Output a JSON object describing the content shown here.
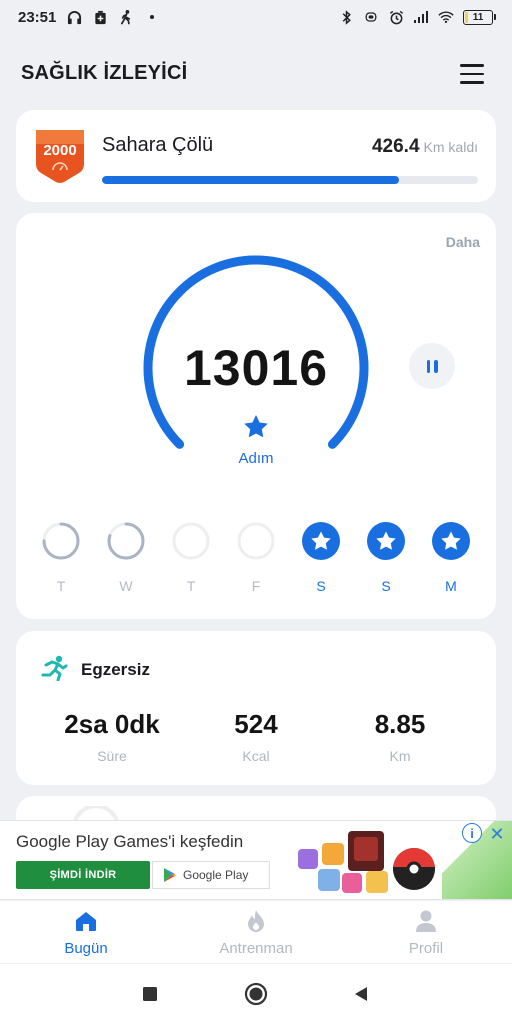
{
  "status_bar": {
    "time": "23:51",
    "battery_level": "11",
    "icons": [
      "headphones-icon",
      "battery-saver-icon",
      "walking-icon",
      "dot-icon",
      "bluetooth-icon",
      "vibrate-icon",
      "alarm-icon",
      "signal-icon",
      "wifi-icon",
      "battery-icon"
    ]
  },
  "app_bar": {
    "title": "SAĞLIK İZLEYİCİ",
    "menu_icon": "hamburger-menu-icon"
  },
  "challenge": {
    "badge_number": "2000",
    "name": "Sahara Çölü",
    "remaining_value": "426.4",
    "remaining_unit": "Km kaldı",
    "progress_fraction": 0.79,
    "accent_color": "#e8541f"
  },
  "steps": {
    "more_label": "Daha",
    "value": "13016",
    "unit_label": "Adım",
    "gauge_fraction": 1.0,
    "gauge_color": "#1a6fe0",
    "pause_icon": "pause-icon",
    "week": [
      {
        "label": "T",
        "state": "partial",
        "fraction": 0.75
      },
      {
        "label": "W",
        "state": "partial",
        "fraction": 0.8
      },
      {
        "label": "T",
        "state": "empty",
        "fraction": 0
      },
      {
        "label": "F",
        "state": "empty",
        "fraction": 0
      },
      {
        "label": "S",
        "state": "done",
        "fraction": 1
      },
      {
        "label": "S",
        "state": "done",
        "fraction": 1
      },
      {
        "label": "M",
        "state": "done",
        "fraction": 1
      }
    ]
  },
  "exercise": {
    "title": "Egzersiz",
    "icon": "running-person-icon",
    "stats": [
      {
        "value": "2sa 0dk",
        "label": "Süre"
      },
      {
        "value": "524",
        "label": "Kcal"
      },
      {
        "value": "8.85",
        "label": "Km"
      }
    ]
  },
  "ad": {
    "title": "Google Play Games'i keşfedin",
    "cta": "ŞİMDİ İNDİR",
    "store_badge": "Google Play",
    "info_icon": "info-icon",
    "close_icon": "close-icon"
  },
  "bottom_nav": {
    "items": [
      {
        "label": "Bugün",
        "icon": "home-icon",
        "active": true
      },
      {
        "label": "Antrenman",
        "icon": "flame-icon",
        "active": false
      },
      {
        "label": "Profil",
        "icon": "person-icon",
        "active": false
      }
    ]
  },
  "system_nav": {
    "icons": [
      "recents-square-icon",
      "home-circle-icon",
      "back-triangle-icon"
    ]
  },
  "colors": {
    "primary": "#1a6fe0",
    "background": "#eef0f4",
    "card": "#ffffff",
    "muted": "#b4b8c0"
  }
}
